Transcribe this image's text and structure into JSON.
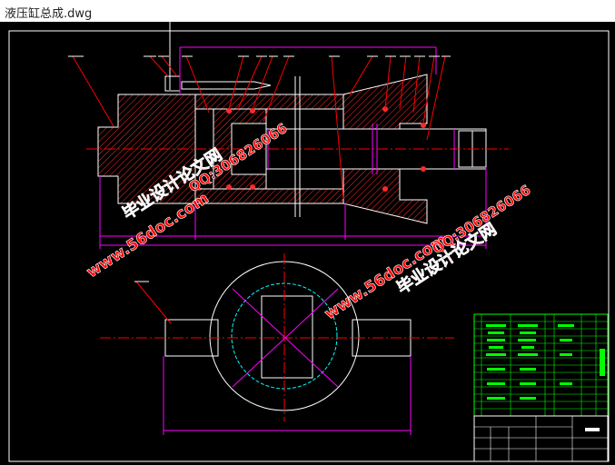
{
  "window": {
    "title": "液压缸总成.dwg"
  },
  "watermarks": [
    {
      "text": "毕业设计论文网"
    },
    {
      "text": "QQ:306826066"
    },
    {
      "text": "www.56doc.com"
    },
    {
      "text": "www.56doc.com"
    },
    {
      "text": "毕业设计论文网"
    },
    {
      "text": "QQ:306826066"
    },
    {
      "text": "www.56doc.com"
    }
  ],
  "colors": {
    "background": "#000000",
    "frame": "#ffffff",
    "hatch": "#ff2a2a",
    "dimension": "#ff00ff",
    "centerline": "#ff0000",
    "bom": "#00ff00",
    "circle": "#00ffff",
    "watermark": "#ff0000",
    "watermark_outline": "#ffffff"
  }
}
